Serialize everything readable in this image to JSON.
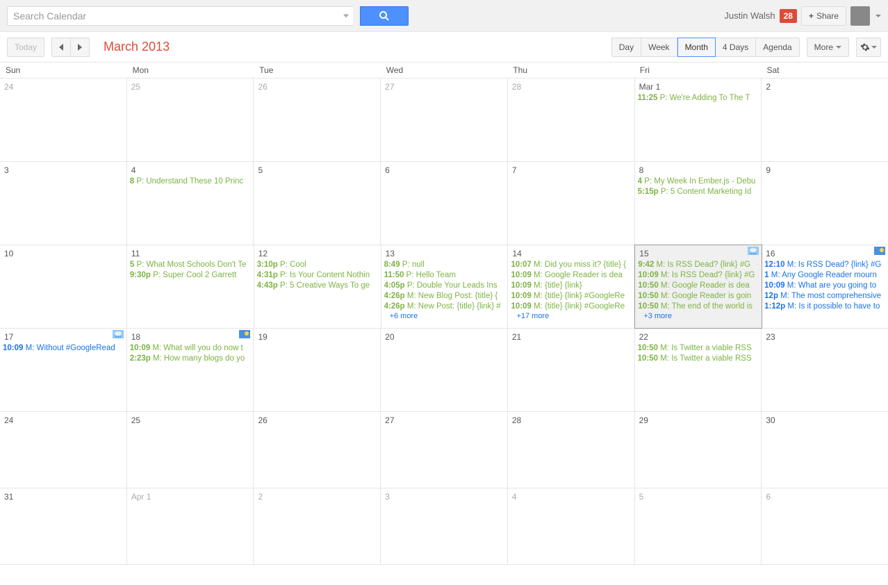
{
  "search": {
    "placeholder": "Search Calendar"
  },
  "user": {
    "name": "Justin Walsh",
    "badge": "28",
    "share_label": "Share"
  },
  "toolbar": {
    "today": "Today",
    "title": "March 2013",
    "views": {
      "day": "Day",
      "week": "Week",
      "month": "Month",
      "days4": "4 Days",
      "agenda": "Agenda"
    },
    "more": "More"
  },
  "day_headers": [
    "Sun",
    "Mon",
    "Tue",
    "Wed",
    "Thu",
    "Fri",
    "Sat"
  ],
  "weeks": [
    {
      "cells": [
        {
          "num": "24",
          "other": true,
          "events": []
        },
        {
          "num": "25",
          "other": true,
          "events": []
        },
        {
          "num": "26",
          "other": true,
          "events": []
        },
        {
          "num": "27",
          "other": true,
          "events": []
        },
        {
          "num": "28",
          "other": true,
          "events": []
        },
        {
          "num": "Mar 1",
          "events": [
            {
              "t": "11:25",
              "txt": "P: We're Adding To The T"
            }
          ]
        },
        {
          "num": "2",
          "events": []
        }
      ]
    },
    {
      "cells": [
        {
          "num": "3",
          "events": []
        },
        {
          "num": "4",
          "events": [
            {
              "t": "8",
              "txt": "P: Understand These 10 Princ"
            }
          ]
        },
        {
          "num": "5",
          "events": []
        },
        {
          "num": "6",
          "events": []
        },
        {
          "num": "7",
          "events": []
        },
        {
          "num": "8",
          "events": [
            {
              "t": "4",
              "txt": "P: My Week In Ember.js - Debu"
            },
            {
              "t": "5:15p",
              "txt": "P: 5 Content Marketing Id"
            }
          ]
        },
        {
          "num": "9",
          "events": []
        }
      ]
    },
    {
      "cells": [
        {
          "num": "10",
          "events": []
        },
        {
          "num": "11",
          "events": [
            {
              "t": "5",
              "txt": "P: What Most Schools Don't Te"
            },
            {
              "t": "9:30p",
              "txt": "P: Super Cool 2 Garrett"
            }
          ]
        },
        {
          "num": "12",
          "events": [
            {
              "t": "3:10p",
              "txt": "P: Cool"
            },
            {
              "t": "4:31p",
              "txt": "P: Is Your Content Nothin"
            },
            {
              "t": "4:43p",
              "txt": "P: 5 Creative Ways To ge"
            }
          ]
        },
        {
          "num": "13",
          "events": [
            {
              "t": "8:49",
              "txt": "P: null"
            },
            {
              "t": "11:50",
              "txt": "P: Hello Team"
            },
            {
              "t": "4:05p",
              "txt": "P: Double Your Leads Ins"
            },
            {
              "t": "4:26p",
              "txt": "M: New Blog Post: {title} {"
            },
            {
              "t": "4:26p",
              "txt": "M: New Post: {title} {link} #"
            }
          ],
          "more": "+6 more"
        },
        {
          "num": "14",
          "events": [
            {
              "t": "10:07",
              "txt": "M: Did you miss it? {title} {"
            },
            {
              "t": "10:09",
              "txt": "M: Google Reader is dea"
            },
            {
              "t": "10:09",
              "txt": "M: {title} {link}"
            },
            {
              "t": "10:09",
              "txt": "M: {title} {link} #GoogleRe"
            },
            {
              "t": "10:09",
              "txt": "M: {title} {link} #GoogleRe"
            }
          ],
          "more": "+17 more"
        },
        {
          "num": "15",
          "today": true,
          "weather": "rain",
          "events": [
            {
              "t": "9:42",
              "txt": "M: Is RSS Dead? {link} #G"
            },
            {
              "t": "10:09",
              "txt": "M: Is RSS Dead? {link} #G"
            },
            {
              "t": "10:50",
              "txt": "M: Google Reader is dea"
            },
            {
              "t": "10:50",
              "txt": "M: Google Reader is goin"
            },
            {
              "t": "10:50",
              "txt": "M: The end of the world is"
            }
          ],
          "more": "+3 more"
        },
        {
          "num": "16",
          "weather": "sun",
          "events": [
            {
              "t": "12:10",
              "txt": "M: Is RSS Dead? {link} #G",
              "blue": true
            },
            {
              "t": "1",
              "txt": "M: Any Google Reader mourn",
              "blue": true
            },
            {
              "t": "10:09",
              "txt": "M: What are you going to",
              "blue": true
            },
            {
              "t": "12p",
              "txt": "M: The most comprehensive",
              "blue": true
            },
            {
              "t": "1:12p",
              "txt": "M: Is it possible to have to",
              "blue": true
            }
          ]
        }
      ]
    },
    {
      "cells": [
        {
          "num": "17",
          "weather": "rain",
          "events": [
            {
              "t": "10:09",
              "txt": "M: Without #GoogleRead",
              "blue": true
            }
          ]
        },
        {
          "num": "18",
          "weather": "sun",
          "events": [
            {
              "t": "10:09",
              "txt": "M: What will you do now t"
            },
            {
              "t": "2:23p",
              "txt": "M: How many blogs do yo"
            }
          ]
        },
        {
          "num": "19",
          "events": []
        },
        {
          "num": "20",
          "events": []
        },
        {
          "num": "21",
          "events": []
        },
        {
          "num": "22",
          "events": [
            {
              "t": "10:50",
              "txt": "M: Is Twitter a viable RSS"
            },
            {
              "t": "10:50",
              "txt": "M: Is Twitter a viable RSS"
            }
          ]
        },
        {
          "num": "23",
          "events": []
        }
      ]
    },
    {
      "cells": [
        {
          "num": "24",
          "events": []
        },
        {
          "num": "25",
          "events": []
        },
        {
          "num": "26",
          "events": []
        },
        {
          "num": "27",
          "events": []
        },
        {
          "num": "28",
          "events": []
        },
        {
          "num": "29",
          "events": []
        },
        {
          "num": "30",
          "events": []
        }
      ]
    },
    {
      "cells": [
        {
          "num": "31",
          "events": []
        },
        {
          "num": "Apr 1",
          "other": true,
          "events": []
        },
        {
          "num": "2",
          "other": true,
          "events": []
        },
        {
          "num": "3",
          "other": true,
          "events": []
        },
        {
          "num": "4",
          "other": true,
          "events": []
        },
        {
          "num": "5",
          "other": true,
          "events": []
        },
        {
          "num": "6",
          "other": true,
          "events": []
        }
      ]
    }
  ]
}
